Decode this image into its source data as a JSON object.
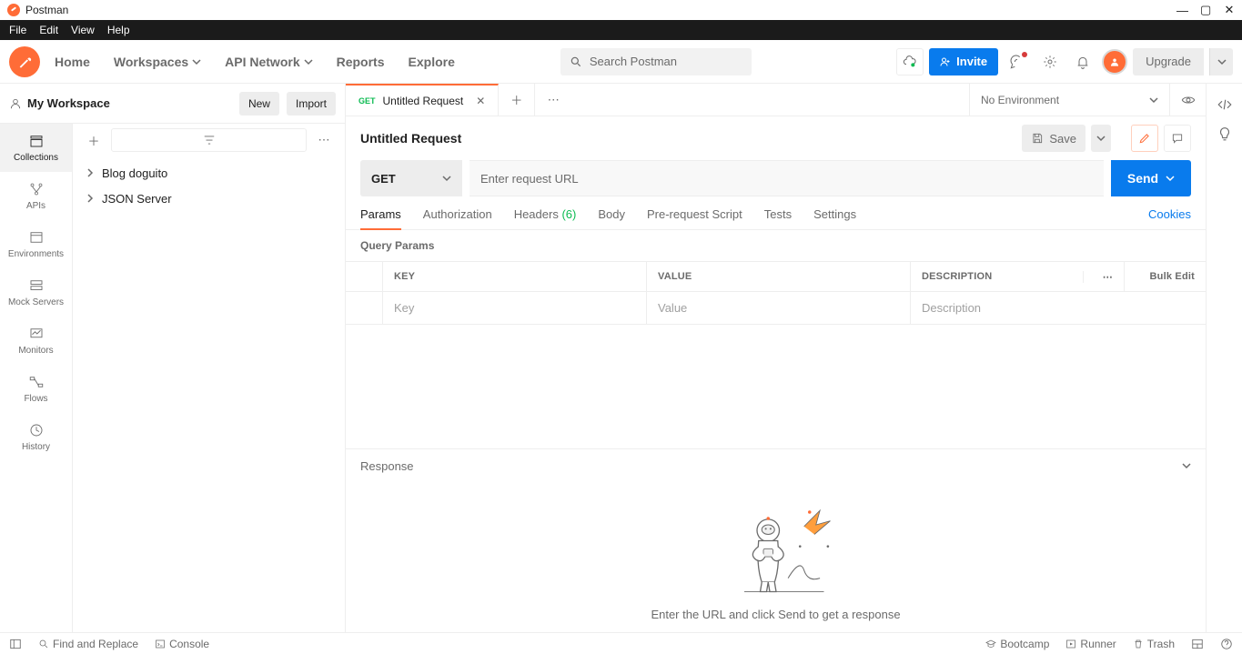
{
  "titlebar": {
    "app_name": "Postman"
  },
  "menubar": [
    "File",
    "Edit",
    "View",
    "Help"
  ],
  "topnav": {
    "items": [
      "Home",
      "Workspaces",
      "API Network",
      "Reports",
      "Explore"
    ],
    "search_placeholder": "Search Postman",
    "invite_label": "Invite",
    "upgrade_label": "Upgrade"
  },
  "workspace": {
    "title": "My Workspace",
    "new_label": "New",
    "import_label": "Import"
  },
  "leftrail": [
    "Collections",
    "APIs",
    "Environments",
    "Mock Servers",
    "Monitors",
    "Flows",
    "History"
  ],
  "tree": [
    "Blog doguito",
    "JSON Server"
  ],
  "tab": {
    "method": "GET",
    "title": "Untitled Request"
  },
  "env_selector": "No Environment",
  "request": {
    "title": "Untitled Request",
    "save_label": "Save",
    "method": "GET",
    "url_placeholder": "Enter request URL",
    "send_label": "Send",
    "tabs": [
      "Params",
      "Authorization",
      "Headers",
      "Body",
      "Pre-request Script",
      "Tests",
      "Settings"
    ],
    "headers_count": "(6)",
    "cookies_label": "Cookies",
    "query_params_label": "Query Params",
    "columns": {
      "key": "KEY",
      "value": "VALUE",
      "desc": "DESCRIPTION",
      "bulk": "Bulk Edit"
    },
    "placeholders": {
      "key": "Key",
      "value": "Value",
      "desc": "Description"
    }
  },
  "response": {
    "title": "Response",
    "empty_text": "Enter the URL and click Send to get a response"
  },
  "statusbar": {
    "find_replace": "Find and Replace",
    "console": "Console",
    "bootcamp": "Bootcamp",
    "runner": "Runner",
    "trash": "Trash"
  }
}
